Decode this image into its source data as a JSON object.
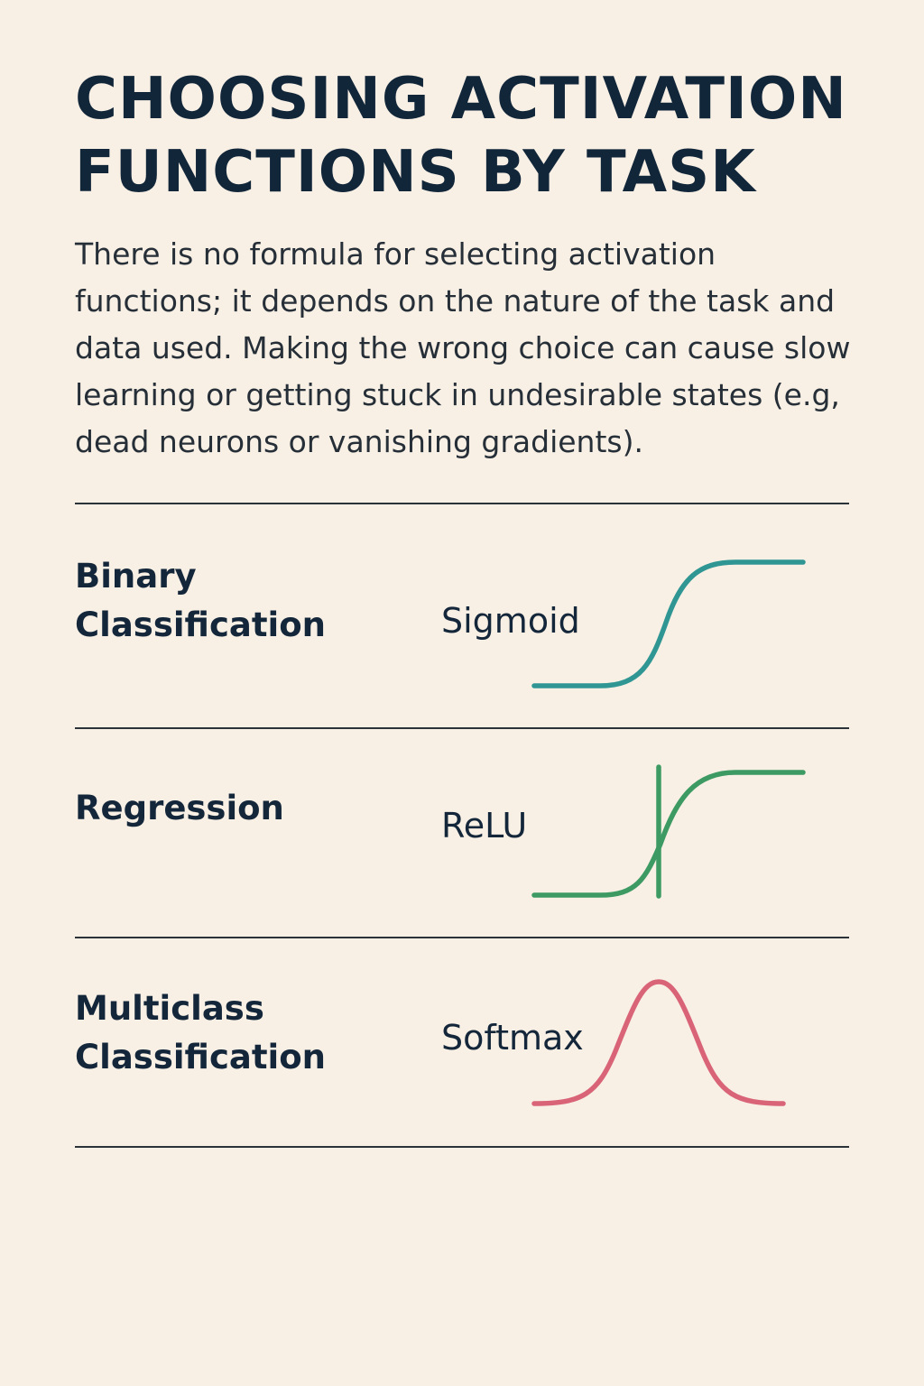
{
  "header": {
    "title_line1": "CHOOSING ACTIVATION",
    "title_line2": "FUNCTIONS BY TASK",
    "description": "There is no formula for selecting activation functions; it depends on the nature of the task and data used. Making the wrong choice can cause slow learning or getting stuck in undesirable states (e.g, dead neurons or vanishing gradients)."
  },
  "rows": [
    {
      "task_line1": "Binary",
      "task_line2": "Classification",
      "function": "Sigmoid",
      "curve_icon": "sigmoid-curve",
      "curve_color": "#2f9693"
    },
    {
      "task_line1": "Regression",
      "task_line2": "",
      "function": "ReLU",
      "curve_icon": "relu-curve",
      "curve_color": "#3c9a62"
    },
    {
      "task_line1": "Multiclass",
      "task_line2": "Classification",
      "function": "Softmax",
      "curve_icon": "softmax-curve",
      "curve_color": "#d96478"
    }
  ]
}
